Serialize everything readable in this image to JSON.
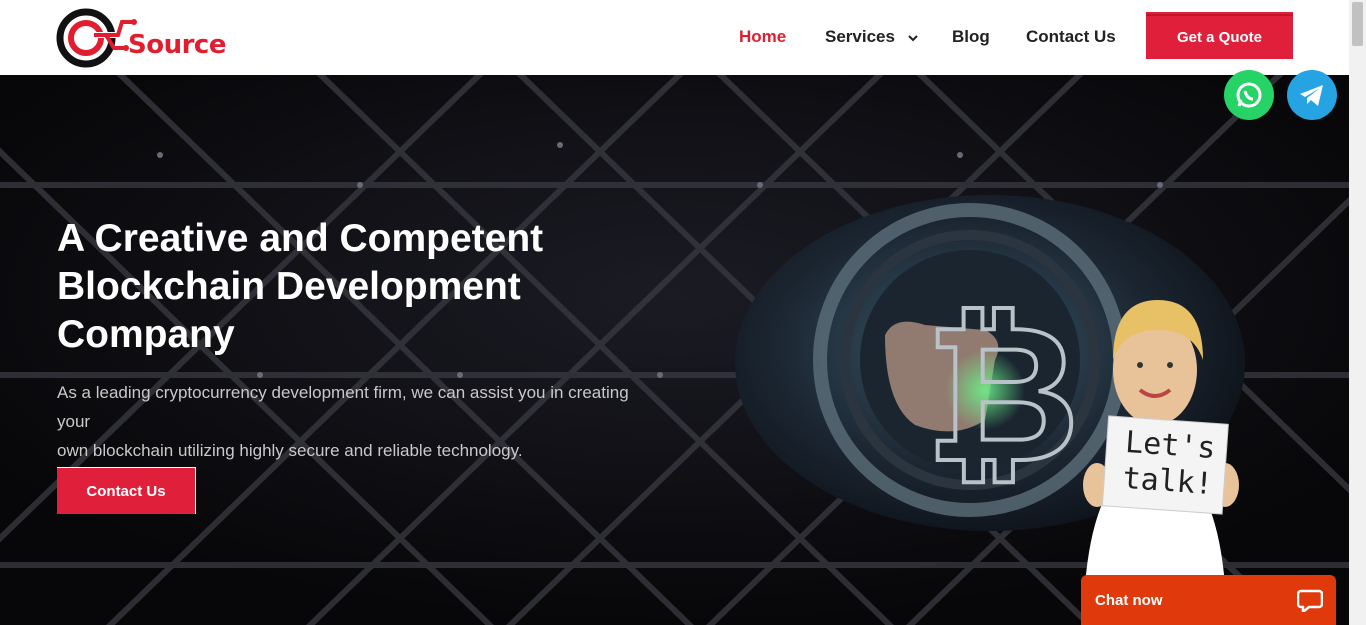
{
  "brand": {
    "logo_text": "Source",
    "colors": {
      "accent": "#e0203a",
      "header_bg": "#ffffff",
      "hero_bg": "#0b0b10",
      "chat": "#e0390b",
      "whatsapp": "#25d366",
      "telegram": "#25a3e2"
    }
  },
  "nav": {
    "items": [
      {
        "label": "Home",
        "active": true
      },
      {
        "label": "Services",
        "has_dropdown": true
      },
      {
        "label": "Blog"
      },
      {
        "label": "Contact Us"
      }
    ],
    "cta_label": "Get a Quote"
  },
  "hero": {
    "title_lines": [
      "A Creative and Competent",
      "Blockchain Development",
      "Company"
    ],
    "desc_lines": [
      "As a leading cryptocurrency development firm, we can assist you in creating your",
      "own blockchain utilizing highly secure and reliable technology."
    ],
    "button_label": "Contact Us",
    "sign_lines": [
      "Let's",
      "talk!"
    ]
  },
  "floating": {
    "icons": [
      "whatsapp-icon",
      "telegram-icon"
    ]
  },
  "chat": {
    "label": "Chat now",
    "icon": "chat-bubble-icon"
  }
}
